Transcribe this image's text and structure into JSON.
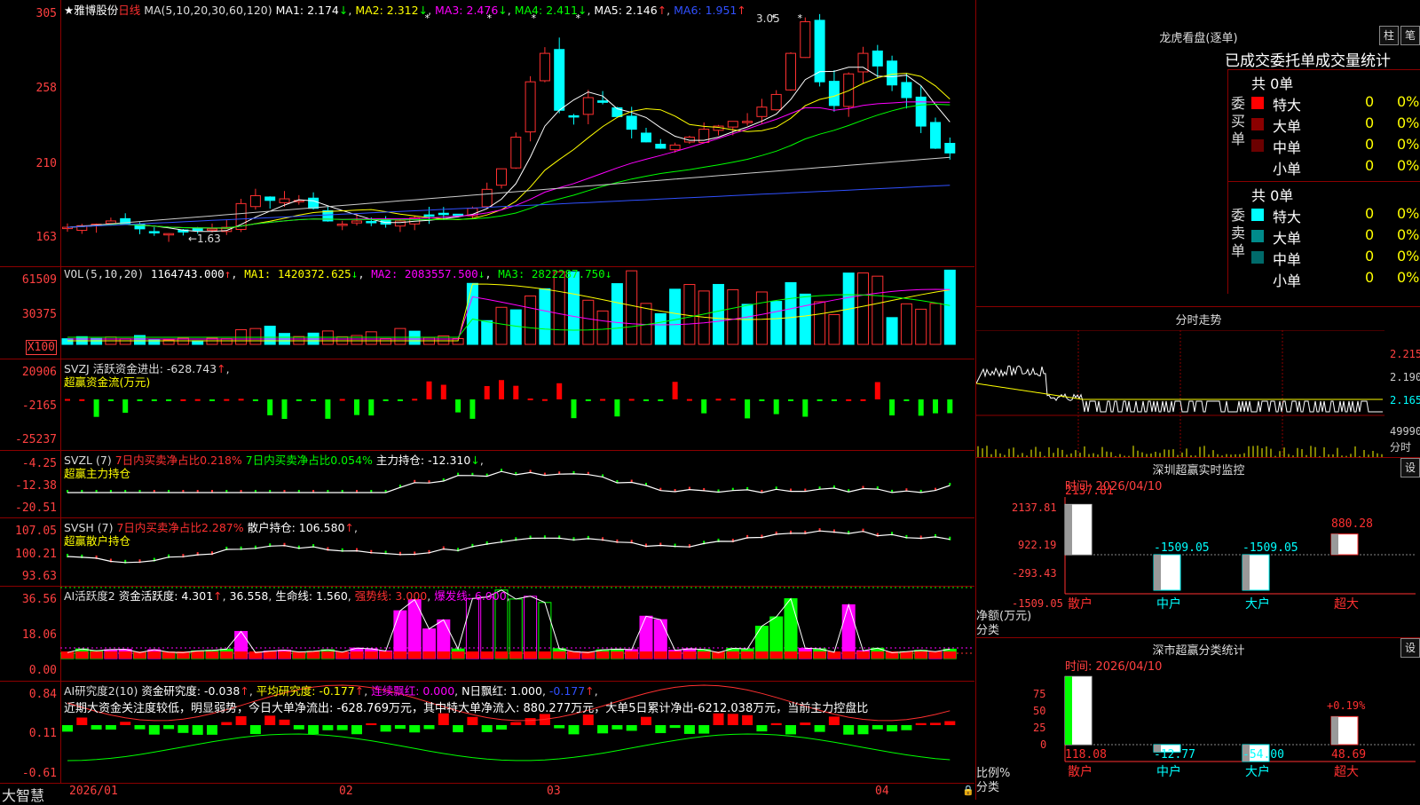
{
  "kline": {
    "stock_name": "★雅博股份",
    "period": "日线",
    "ma_params": "MA(5,10,20,30,60,120)",
    "ma": [
      {
        "label": "MA1: 2.174",
        "arrow": "↓",
        "color": "#ffffff"
      },
      {
        "label": "MA2: 2.312",
        "arrow": "↓",
        "color": "#ffff00"
      },
      {
        "label": "MA3: 2.476",
        "arrow": "↓",
        "color": "#ff00ff"
      },
      {
        "label": "MA4: 2.411",
        "arrow": "↓",
        "color": "#00ff00"
      },
      {
        "label": "MA5: 2.146",
        "arrow": "↑",
        "color": "#cccccc"
      },
      {
        "label": "MA6: 1.951",
        "arrow": "↑",
        "color": "#3050ff"
      }
    ],
    "y_ticks": [
      "305",
      "258",
      "210",
      "163"
    ],
    "high_mark": "3.05",
    "low_mark": "←1.63"
  },
  "volume": {
    "header": "VOL(5,10,20)",
    "value": "1164743.000",
    "ma1": "MA1: 1420372.625",
    "ma2": "MA2: 2083557.500",
    "ma3": "MA3: 2822287.750",
    "y_ticks": [
      "61509",
      "30375"
    ],
    "unit": "X100"
  },
  "svzj": {
    "header": "SVZJ  活跃资金进出: -628.743",
    "arrow": "↑",
    "subtitle": "超赢资金流(万元)",
    "y_ticks": [
      "20906",
      "-2165",
      "-25237"
    ]
  },
  "svzl": {
    "name": "SVZL (7)",
    "t1": "7日内买卖净占比0.218%",
    "t2": "7日内买卖净占比0.054%",
    "t3": "主力持仓: -12.310",
    "arrow": "↓",
    "subtitle": "超赢主力持仓",
    "y_ticks": [
      "-4.25",
      "-12.38",
      "-20.51"
    ]
  },
  "svsh": {
    "name": "SVSH (7)",
    "t1": "7日内买卖净占比2.287%",
    "t2": "散户持仓: 106.580",
    "arrow": "↑",
    "subtitle": "超赢散户持仓",
    "y_ticks": [
      "107.05",
      "100.21",
      "93.63"
    ]
  },
  "ai_active": {
    "name": "AI活跃度2",
    "t1": "资金活跃度: 4.301",
    "t2": "36.558",
    "t3": "生命线: 1.560",
    "t4": "强势线: 3.000",
    "t5": "爆发线: 6.000",
    "y_ticks": [
      "36.56",
      "18.06",
      "0.00"
    ]
  },
  "ai_research": {
    "name": "AI研究度2(10)",
    "t1": "资金研究度: -0.038",
    "t2": "平均研究度: -0.177",
    "t3": "连续飘红: 0.000",
    "t4": "N日飘红: 1.000",
    "t5": "-0.177",
    "text": "近期大资金关注度较低，明显弱势，今日大单净流出: -628.769万元，其中特大单净流入: 880.277万元，大单5日累计净出-6212.038万元，当前主力控盘比",
    "y_ticks": [
      "0.84",
      "0.11",
      "-0.61"
    ]
  },
  "dates": [
    "2026/01",
    "02",
    "03",
    "04"
  ],
  "brand": "大智慧",
  "dragon": {
    "title": "龙虎看盘(逐单)",
    "btn1": "柱",
    "btn2": "笔",
    "subtitle": "已成交委托单成交量统计",
    "buy_label": "委买单",
    "sell_label": "委卖单",
    "buy_total": "共 0单",
    "sell_total": "共 0单",
    "rows": [
      "特大",
      "大单",
      "中单",
      "小单"
    ],
    "buy_colors": [
      "#ff0000",
      "#8b0000",
      "#6b0000",
      "#000000"
    ],
    "sell_colors": [
      "#00ffff",
      "#008b8b",
      "#006b6b",
      "#000000"
    ],
    "qty": "0",
    "pct": "0%"
  },
  "minute": {
    "title": "分时走势",
    "prices": [
      "2.215",
      "2.190",
      "2.165"
    ],
    "vol_label": "49990",
    "vol_unit": "分时"
  },
  "sz_monitor": {
    "title": "深圳超赢实时监控",
    "btn": "设",
    "time": "时间: 2026/04/10",
    "y_ticks": [
      "2137.81",
      "922.19",
      "-293.43",
      "-1509.05"
    ],
    "ylabel1": "净额(万元)",
    "ylabel2": "分类",
    "categories": [
      "散户",
      "中户",
      "大户",
      "超大"
    ],
    "values": [
      2137.81,
      -1509.05,
      -1509.05,
      880.28
    ],
    "value_labels": [
      "2137.81",
      "-1509.05",
      "-1509.05",
      "880.28"
    ]
  },
  "sz_stats": {
    "title": "深市超赢分类统计",
    "btn": "设",
    "time": "时间: 2026/04/10",
    "y_ticks": [
      "75",
      "50",
      "25",
      "0"
    ],
    "ylabel1": "比例%",
    "ylabel2": "分类",
    "categories": [
      "散户",
      "中户",
      "大户",
      "超大"
    ],
    "values": [
      118.08,
      -12.77,
      -54.0,
      48.69
    ],
    "value_labels": [
      "118.08",
      "-12.77",
      "-54.00",
      "48.69"
    ],
    "extra": "+0.19%"
  },
  "chart_data": {
    "type": "bar",
    "title": "深圳超赢实时监控",
    "ylabel": "净额(万元)",
    "xlabel": "分类",
    "categories": [
      "散户",
      "中户",
      "大户",
      "超大"
    ],
    "values": [
      2137.81,
      -1509.05,
      -1509.05,
      880.28
    ],
    "ylim": [
      -1509.05,
      2137.81
    ]
  }
}
